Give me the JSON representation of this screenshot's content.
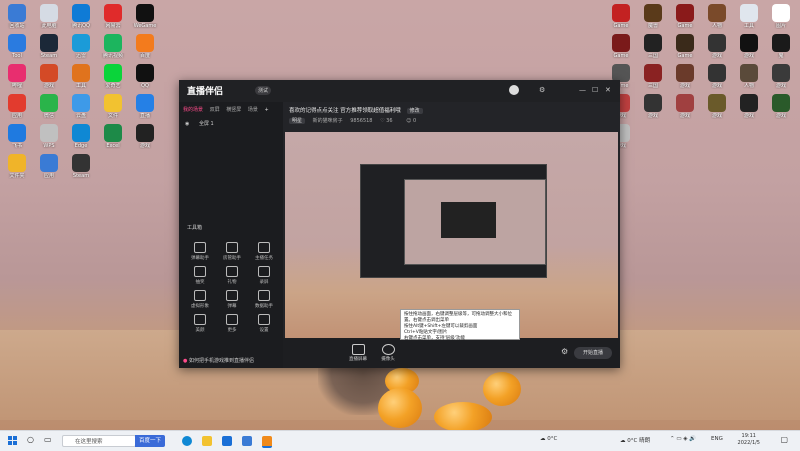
{
  "desktop": {
    "left_icons": [
      {
        "label": "回收站",
        "color": "#3a7bd5"
      },
      {
        "label": "此电脑",
        "color": "#d5dbe4"
      },
      {
        "label": "腾讯QQ",
        "color": "#0f7bd6"
      },
      {
        "label": "网易云",
        "color": "#e02b2b"
      },
      {
        "label": "WeGame",
        "color": "#111"
      },
      {
        "label": "Tool",
        "color": "#2a7be0"
      },
      {
        "label": "Steam",
        "color": "#1b2838"
      },
      {
        "label": "迅雷",
        "color": "#1b9bd8"
      },
      {
        "label": "腾讯视频",
        "color": "#1cb55e"
      },
      {
        "label": "百度",
        "color": "#f37b1d"
      },
      {
        "label": "哔哩",
        "color": "#e82e6f"
      },
      {
        "label": "游戏",
        "color": "#d44a26"
      },
      {
        "label": "工具",
        "color": "#e0731d"
      },
      {
        "label": "爱奇艺",
        "color": "#0ad43a"
      },
      {
        "label": "QQ",
        "color": "#111"
      },
      {
        "label": "应用",
        "color": "#e23b2e"
      },
      {
        "label": "微信",
        "color": "#2ab44a"
      },
      {
        "label": "云盘",
        "color": "#3e9ae8"
      },
      {
        "label": "文件",
        "color": "#f2c230"
      },
      {
        "label": "直播",
        "color": "#2580e6"
      },
      {
        "label": "飞书",
        "color": "#1f7ae0"
      },
      {
        "label": "WPS",
        "color": "#c0c0c0"
      },
      {
        "label": "Edge",
        "color": "#0f88d4"
      },
      {
        "label": "Excel",
        "color": "#1d8a48"
      },
      {
        "label": "游戏",
        "color": "#222"
      },
      {
        "label": "文件夹",
        "color": "#f0b429"
      },
      {
        "label": "应用",
        "color": "#3a7bd5"
      },
      {
        "label": "Steam",
        "color": "#333"
      }
    ],
    "right_icons": [
      {
        "label": "Game",
        "color": "#c32222"
      },
      {
        "label": "魔兽",
        "color": "#5a3a1a"
      },
      {
        "label": "Game",
        "color": "#8a1a1a"
      },
      {
        "label": "人物",
        "color": "#7a4a2a"
      },
      {
        "label": "工具",
        "color": "#e0e6ee"
      },
      {
        "label": "图片",
        "color": "#fff"
      },
      {
        "label": "Game",
        "color": "#7a1a1a"
      },
      {
        "label": "三国",
        "color": "#222"
      },
      {
        "label": "Game",
        "color": "#3a2a1a"
      },
      {
        "label": "游戏",
        "color": "#333"
      },
      {
        "label": "游戏",
        "color": "#111"
      },
      {
        "label": "鬼",
        "color": "#1a1a1a"
      },
      {
        "label": "Game",
        "color": "#555"
      },
      {
        "label": "三国",
        "color": "#8a2222"
      },
      {
        "label": "游戏",
        "color": "#6a3a2a"
      },
      {
        "label": "游戏",
        "color": "#333"
      },
      {
        "label": "人物",
        "color": "#5a4a3a"
      },
      {
        "label": "游戏",
        "color": "#3a3a3a"
      },
      {
        "label": "游戏",
        "color": "#c04040"
      },
      {
        "label": "游戏",
        "color": "#333"
      },
      {
        "label": "游戏",
        "color": "#a04040"
      },
      {
        "label": "游戏",
        "color": "#6a5a2a"
      },
      {
        "label": "游戏",
        "color": "#222"
      },
      {
        "label": "游戏",
        "color": "#2a5a2a"
      },
      {
        "label": "游戏",
        "color": "#c0c0c0"
      }
    ]
  },
  "app": {
    "brand": "直播伴侣",
    "brand_badge": "测试",
    "tabs": [
      "我的场景",
      "双屏",
      "横竖屏",
      "场景"
    ],
    "scene_label": "全屏 1",
    "tools_title": "工具箱",
    "tools": [
      "弹幕助手",
      "房管助手",
      "主播任务",
      "抽奖",
      "礼物",
      "录屏",
      "虚拟形象",
      "弹幕",
      "数据助手",
      "美颜",
      "更多",
      "设置"
    ],
    "footer_text": "如何把手机游戏推到直播伴侣",
    "room_title": "喜欢的记得点点关注 官方推荐领取超值福利哦",
    "room_edit": "修改",
    "meta_chip": "明星",
    "meta_category": "新的猫咪房子",
    "meta_id": "9856518",
    "meta_likes": "36",
    "meta_fans": "0",
    "bottom_buttons": [
      "直播屏幕",
      "摄像头"
    ],
    "start_label": "开始直播"
  },
  "tooltip": {
    "lines": [
      "按住拖动画面，右键调整层级等，可拖动调整大小和位置。右键点击调出菜单",
      "按住Alt键+Shift+左键可以裁剪画面",
      "Ctrl+V粘贴文字/图片",
      "右键点击菜单，支持'层级'功能"
    ]
  },
  "taskbar": {
    "search_placeholder": "在这里搜索",
    "search_button": "百度一下",
    "weather": "0°C",
    "tray_weather": "0°C 晴朗",
    "lang": "ENG",
    "time": "19:11",
    "date": "2022/1/5"
  }
}
